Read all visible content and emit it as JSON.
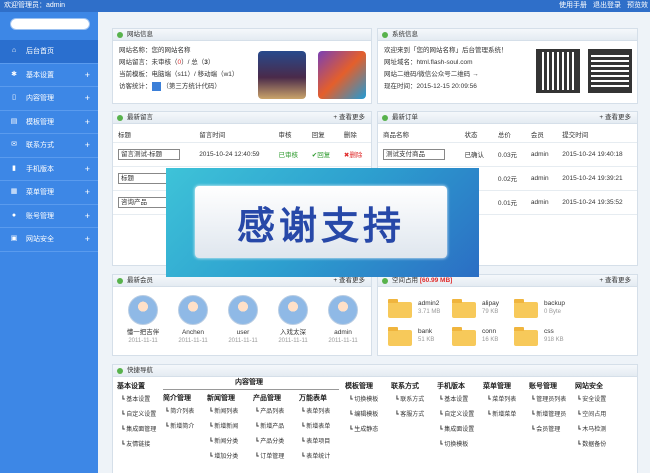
{
  "topbar": {
    "welcome": "欢迎管理员：admin",
    "links": [
      "使用手册",
      "退出登录",
      "预览效"
    ]
  },
  "sidebar": {
    "items": [
      {
        "label": "后台首页",
        "icon": "home-icon"
      },
      {
        "label": "基本设置",
        "icon": "gear-icon"
      },
      {
        "label": "内容管理",
        "icon": "document-icon"
      },
      {
        "label": "模板管理",
        "icon": "template-icon"
      },
      {
        "label": "联系方式",
        "icon": "mail-icon"
      },
      {
        "label": "手机版本",
        "icon": "mobile-icon"
      },
      {
        "label": "菜单管理",
        "icon": "grid-icon"
      },
      {
        "label": "账号管理",
        "icon": "user-icon"
      },
      {
        "label": "网站安全",
        "icon": "lock-icon"
      }
    ]
  },
  "site_info": {
    "title": "网站信息",
    "name": "网站名称：您的网站名称",
    "msg_prefix": "网站留言：未审核（",
    "msg_pending": "0",
    "msg_mid": "）/ 总（",
    "msg_total": "3",
    "msg_suffix": "）",
    "template": "当前模板：电脑端（s11）/ 移动端（w1）",
    "stats_label": "访客统计：",
    "stats_note": "（第三方统计代码）"
  },
  "system_info": {
    "title": "系统信息",
    "welcome": "欢迎来到「您的网站名称」后台管理系统！",
    "domain": "网址域名：html.flash-soul.com",
    "qr": "网站二维码/微信公众号二维码 →",
    "time": "现在时间：2015-12-15 20:09:56"
  },
  "messages": {
    "title": "最新留言",
    "more": "+ 查看更多",
    "headers": [
      "标题",
      "留言时间",
      "审核",
      "回复",
      "删除"
    ],
    "rows": [
      {
        "title": "留言测试-标题",
        "time": "2015-10-24 12:40:59",
        "status": "已审核",
        "reply": "✔回复",
        "del": "✖删除"
      },
      {
        "title": "标题",
        "time": "",
        "status": "",
        "reply": "",
        "del": ""
      },
      {
        "title": "咨询产品",
        "time": "",
        "status": "",
        "reply": "",
        "del": ""
      }
    ]
  },
  "orders": {
    "title": "最新订单",
    "more": "+ 查看更多",
    "headers": [
      "商品名称",
      "状态",
      "总价",
      "会员",
      "提交时间"
    ],
    "rows": [
      {
        "name": "测试支付商品",
        "status": "已确认",
        "price": "0.03元",
        "member": "admin",
        "time": "2015-10-24 19:40:18"
      },
      {
        "name": "",
        "status": "",
        "price": "0.02元",
        "member": "admin",
        "time": "2015-10-24 19:39:21"
      },
      {
        "name": "",
        "status": "",
        "price": "0.01元",
        "member": "admin",
        "time": "2015-10-24 19:35:52"
      }
    ]
  },
  "members": {
    "title": "最新会员",
    "more": "+ 查看更多",
    "list": [
      {
        "name": "懂一把吉伴",
        "date": "2011-11-11"
      },
      {
        "name": "Anchen",
        "date": "2011-11-11"
      },
      {
        "name": "user",
        "date": "2011-11-11"
      },
      {
        "name": "入戏太深",
        "date": "2011-11-11"
      },
      {
        "name": "admin",
        "date": "2011-11-11"
      }
    ]
  },
  "space": {
    "title": "空间占用",
    "used": "[60.99 MB]",
    "folders": [
      {
        "name": "admin2",
        "size": "3.71 MB"
      },
      {
        "name": "alipay",
        "size": "79 KB"
      },
      {
        "name": "backup",
        "size": "0 Byte"
      },
      {
        "name": "bank",
        "size": "51 KB"
      },
      {
        "name": "conn",
        "size": "16 KB"
      },
      {
        "name": "css",
        "size": "918 KB"
      }
    ]
  },
  "quicknav": {
    "title": "快捷导航",
    "basic": {
      "head": "基本设置",
      "items": [
        "基本设置",
        "自定义设置",
        "集成面管理",
        "友情链接"
      ]
    },
    "content_head": "内容管理",
    "intro": {
      "head": "简介管理",
      "items": [
        "简介列表",
        "新增简介"
      ]
    },
    "news": {
      "head": "新闻管理",
      "items": [
        "新闻列表",
        "新增新闻",
        "新闻分类",
        "增加分类"
      ]
    },
    "product": {
      "head": "产品管理",
      "items": [
        "产品列表",
        "新增产品",
        "产品分类",
        "订单管理"
      ]
    },
    "multi": {
      "head": "万能表单",
      "items": [
        "表单列表",
        "新增表单",
        "表单项目",
        "表单统计"
      ]
    },
    "template": {
      "head": "模板管理",
      "items": [
        "切换模板",
        "编辑模板",
        "生成静态"
      ]
    },
    "contact": {
      "head": "联系方式",
      "items": [
        "联系方式",
        "客服方式"
      ]
    },
    "mobile": {
      "head": "手机版本",
      "items": [
        "基本设置",
        "自定义设置",
        "集成面设置",
        "切换模板"
      ]
    },
    "menu": {
      "head": "菜单管理",
      "items": [
        "菜单列表",
        "新增菜单"
      ]
    },
    "account": {
      "head": "账号管理",
      "items": [
        "管理员列表",
        "新增管理员",
        "会员管理"
      ]
    },
    "security": {
      "head": "网站安全",
      "items": [
        "安全设置",
        "空间占用",
        "木马检测",
        "数据备份"
      ]
    }
  },
  "banner": {
    "text": "感谢支持"
  }
}
